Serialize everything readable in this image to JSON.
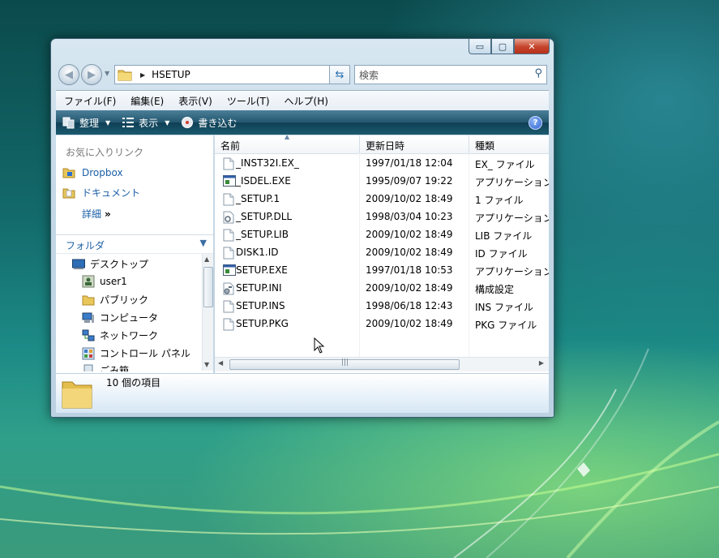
{
  "window": {
    "caption_buttons": {
      "minimize": "▭",
      "maximize": "▢",
      "close": "✕"
    }
  },
  "address_bar": {
    "current_folder": "HSETUP",
    "search_placeholder": "検索"
  },
  "menu": [
    "ファイル(F)",
    "編集(E)",
    "表示(V)",
    "ツール(T)",
    "ヘルプ(H)"
  ],
  "toolbar": {
    "organize": "整理",
    "view": "表示",
    "burn": "書き込む",
    "help": "?"
  },
  "favorites": {
    "title": "お気に入りリンク",
    "items": [
      "Dropbox",
      "ドキュメント"
    ],
    "more": "詳細",
    "more_glyph": "»"
  },
  "folders": {
    "title": "フォルダ",
    "items": [
      "デスクトップ",
      "user1",
      "パブリック",
      "コンピュータ",
      "ネットワーク",
      "コントロール パネル",
      "ごみ箱"
    ]
  },
  "file_list": {
    "columns": [
      "名前",
      "更新日時",
      "種類"
    ],
    "rows": [
      {
        "name": "_INST32I.EX_",
        "date": "1997/01/18 12:04",
        "type": "EX_ ファイル",
        "icon": "blank-file-icon"
      },
      {
        "name": "_ISDEL.EXE",
        "date": "1995/09/07 19:22",
        "type": "アプリケーション",
        "icon": "exe-icon"
      },
      {
        "name": "_SETUP.1",
        "date": "2009/10/02 18:49",
        "type": "1 ファイル",
        "icon": "blank-file-icon"
      },
      {
        "name": "_SETUP.DLL",
        "date": "1998/03/04 10:23",
        "type": "アプリケーション",
        "icon": "dll-icon"
      },
      {
        "name": "_SETUP.LIB",
        "date": "2009/10/02 18:49",
        "type": "LIB ファイル",
        "icon": "blank-file-icon"
      },
      {
        "name": "DISK1.ID",
        "date": "2009/10/02 18:49",
        "type": "ID ファイル",
        "icon": "blank-file-icon"
      },
      {
        "name": "SETUP.EXE",
        "date": "1997/01/18 10:53",
        "type": "アプリケーション",
        "icon": "exe-icon"
      },
      {
        "name": "SETUP.INI",
        "date": "2009/10/02 18:49",
        "type": "構成設定",
        "icon": "ini-icon"
      },
      {
        "name": "SETUP.INS",
        "date": "1998/06/18 12:43",
        "type": "INS ファイル",
        "icon": "blank-file-icon"
      },
      {
        "name": "SETUP.PKG",
        "date": "2009/10/02 18:49",
        "type": "PKG ファイル",
        "icon": "blank-file-icon"
      }
    ]
  },
  "details": {
    "item_count": "10 個の項目"
  },
  "colors": {
    "link": "#1b5fa6",
    "command_bar": "#1f536a",
    "close_button": "#c5432a"
  }
}
